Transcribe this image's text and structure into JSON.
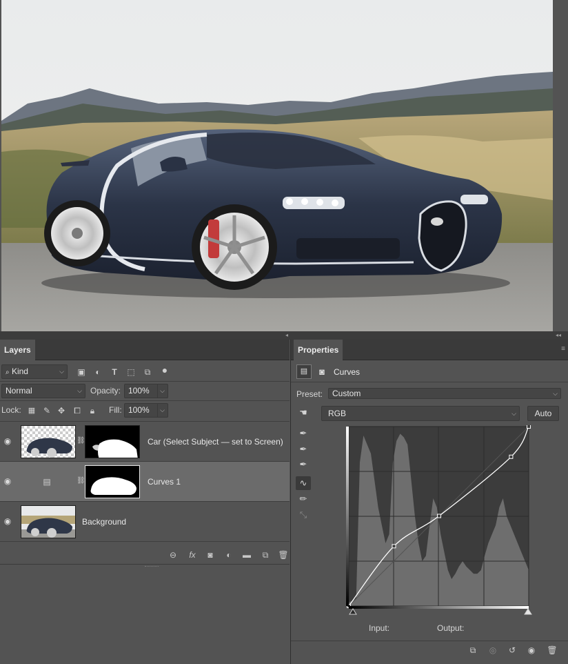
{
  "canvas": {
    "image_description_icon": "car-photo"
  },
  "layers_panel": {
    "tab_label": "Layers",
    "filter_kind": "Kind",
    "blend_mode": "Normal",
    "opacity_label": "Opacity:",
    "opacity_value": "100%",
    "lock_label": "Lock:",
    "fill_label": "Fill:",
    "fill_value": "100%",
    "layers": [
      {
        "name": "Car (Select Subject — set to Screen)",
        "visible": true,
        "selected": false
      },
      {
        "name": "Curves 1",
        "visible": true,
        "selected": true
      },
      {
        "name": "Background",
        "visible": true,
        "selected": false
      }
    ],
    "footer_icons": [
      "link-icon",
      "fx-icon",
      "mask-icon",
      "adjustment-icon",
      "group-icon",
      "new-layer-icon",
      "trash-icon"
    ]
  },
  "properties_panel": {
    "tab_label": "Properties",
    "adjustment_title": "Curves",
    "preset_label": "Preset:",
    "preset_value": "Custom",
    "channel_value": "RGB",
    "auto_label": "Auto",
    "input_label": "Input:",
    "output_label": "Output:",
    "curve_points": [
      [
        0,
        0
      ],
      [
        64,
        85
      ],
      [
        128,
        128
      ],
      [
        230,
        212
      ],
      [
        255,
        255
      ]
    ],
    "histogram": [
      2,
      3,
      4,
      80,
      95,
      90,
      85,
      70,
      55,
      45,
      35,
      40,
      80,
      92,
      96,
      94,
      90,
      70,
      50,
      35,
      25,
      28,
      45,
      60,
      55,
      40,
      30,
      20,
      15,
      18,
      22,
      25,
      22,
      20,
      18,
      18,
      20,
      28,
      35,
      40,
      45,
      55,
      60,
      50,
      45,
      40,
      35,
      30,
      25,
      20
    ],
    "colors": {
      "panel_bg": "#535353",
      "graph_bg": "#3c3c3c",
      "histogram": "#6e6e6e",
      "curve": "#ffffff"
    }
  }
}
